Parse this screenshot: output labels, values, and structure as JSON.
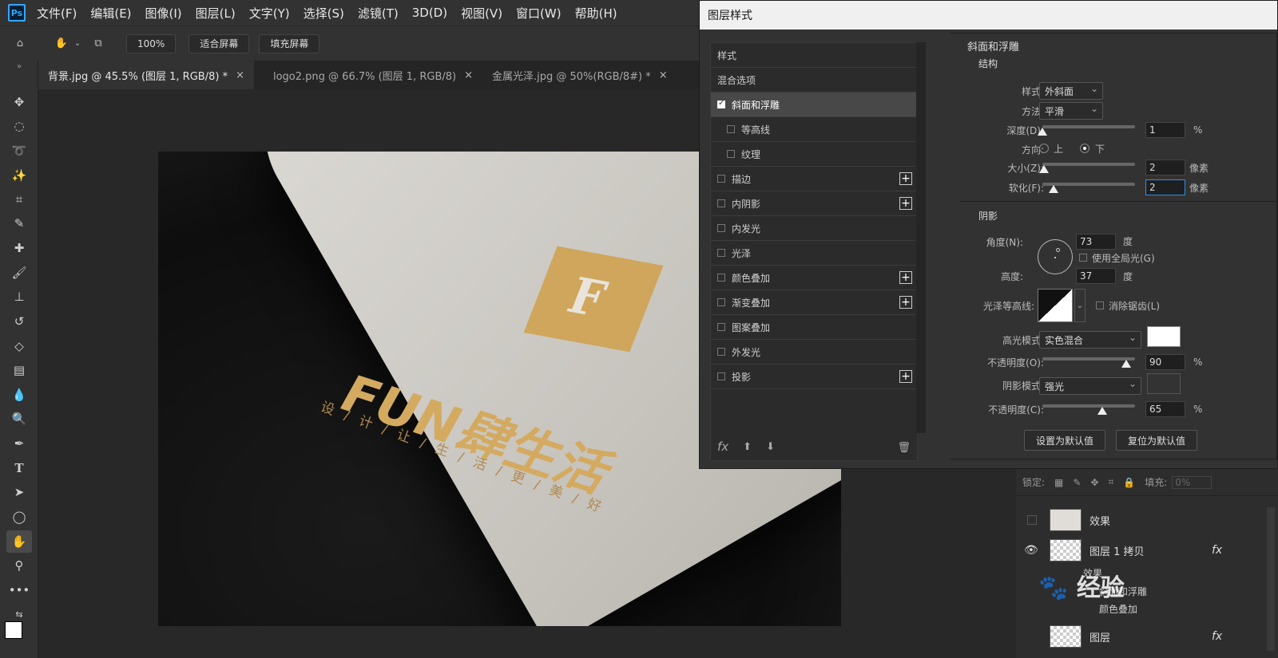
{
  "app": {
    "logo_text": "Ps"
  },
  "menu": [
    "文件(F)",
    "编辑(E)",
    "图像(I)",
    "图层(L)",
    "文字(Y)",
    "选择(S)",
    "滤镜(T)",
    "3D(D)",
    "视图(V)",
    "窗口(W)",
    "帮助(H)"
  ],
  "options": {
    "zoom": "100%",
    "fit_label": "适合屏幕",
    "fill_label": "填充屏幕"
  },
  "tabs": [
    {
      "label": "背景.jpg @ 45.5% (图层 1, RGB/8) *",
      "close": "×"
    },
    {
      "label": "logo2.png @ 66.7% (图层 1, RGB/8)",
      "close": "×"
    },
    {
      "label": "金属光泽.jpg @ 50%(RGB/8#) *",
      "close": "×"
    }
  ],
  "photo": {
    "brand": "FUN肆生活",
    "slogan": "设/计/让/生/活/更/美/好"
  },
  "dialog": {
    "title": "图层样式",
    "styles": [
      {
        "label": "样式",
        "checkbox": false,
        "plus": false
      },
      {
        "label": "混合选项",
        "checkbox": false,
        "plus": false
      },
      {
        "label": "斜面和浮雕",
        "checkbox": true,
        "checked": true,
        "plus": false,
        "active": true
      },
      {
        "label": "等高线",
        "checkbox": true,
        "checked": false,
        "plus": false,
        "indent": true
      },
      {
        "label": "纹理",
        "checkbox": true,
        "checked": false,
        "plus": false,
        "indent": true
      },
      {
        "label": "描边",
        "checkbox": true,
        "checked": false,
        "plus": true
      },
      {
        "label": "内阴影",
        "checkbox": true,
        "checked": false,
        "plus": true
      },
      {
        "label": "内发光",
        "checkbox": true,
        "checked": false,
        "plus": false
      },
      {
        "label": "光泽",
        "checkbox": true,
        "checked": false,
        "plus": false
      },
      {
        "label": "颜色叠加",
        "checkbox": true,
        "checked": false,
        "plus": true
      },
      {
        "label": "渐变叠加",
        "checkbox": true,
        "checked": false,
        "plus": true
      },
      {
        "label": "图案叠加",
        "checkbox": true,
        "checked": false,
        "plus": false
      },
      {
        "label": "外发光",
        "checkbox": true,
        "checked": false,
        "plus": false
      },
      {
        "label": "投影",
        "checkbox": true,
        "checked": false,
        "plus": true
      }
    ],
    "fx_label": "fx",
    "bevel": {
      "section": "斜面和浮雕",
      "structure": "结构",
      "style_label": "样式:",
      "style_value": "外斜面",
      "technique_label": "方法:",
      "technique_value": "平滑",
      "depth_label": "深度(D):",
      "depth_value": "1",
      "depth_unit": "%",
      "direction_label": "方向:",
      "dir_up": "上",
      "dir_down": "下",
      "size_label": "大小(Z):",
      "size_value": "2",
      "size_unit": "像素",
      "soften_label": "软化(F):",
      "soften_value": "2",
      "soften_unit": "像素"
    },
    "shading": {
      "section": "阴影",
      "angle_label": "角度(N):",
      "angle_value": "73",
      "angle_unit": "度",
      "global_light": "使用全局光(G)",
      "altitude_label": "高度:",
      "altitude_value": "37",
      "altitude_unit": "度",
      "gloss_label": "光泽等高线:",
      "antialias": "消除锯齿(L)",
      "highlight_label": "高光模式:",
      "highlight_value": "实色混合",
      "highlight_color": "#ffffff",
      "hl_opacity_label": "不透明度(O):",
      "hl_opacity_value": "90",
      "hl_opacity_unit": "%",
      "shadow_label": "阴影模式:",
      "shadow_value": "强光",
      "shadow_color": "#333333",
      "sh_opacity_label": "不透明度(C):",
      "sh_opacity_value": "65",
      "sh_opacity_unit": "%"
    },
    "set_default": "设置为默认值",
    "reset_default": "复位为默认值"
  },
  "layers": {
    "lock_label": "锁定:",
    "fill_label": "填充:",
    "fill_value": "0%",
    "rows": [
      {
        "name": "效果"
      },
      {
        "name": "图层 1 拷贝",
        "fx": "fx"
      }
    ],
    "effects_label": "效果",
    "effect_items": [
      "斜面和浮雕",
      "颜色叠加"
    ],
    "bottom_row": "图层",
    "bottom_fx": "fx"
  },
  "watermark": "经验"
}
